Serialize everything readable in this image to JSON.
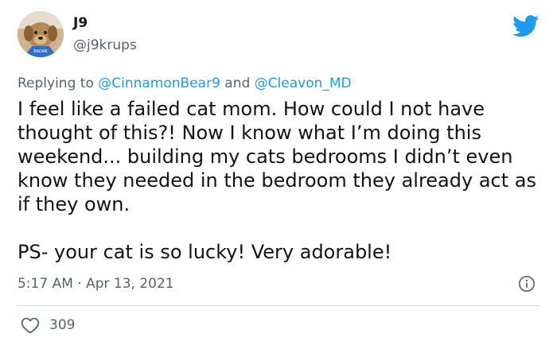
{
  "author": {
    "display_name": "J9",
    "handle": "@j9krups",
    "avatar_icon": "dog-avatar"
  },
  "reply_context": {
    "prefix": "Replying to ",
    "mention_1": "@CinnamonBear9",
    "joiner": " and ",
    "mention_2": "@Cleavon_MD"
  },
  "tweet": {
    "paragraph_1": "I feel like a failed cat mom. How could I not have thought of this?! Now I know what I’m doing this weekend... building my cats bedrooms I didn’t even know they needed in the bedroom they already act as if they own.",
    "paragraph_2": "PS- your cat is so lucky! Very adorable!"
  },
  "meta": {
    "timestamp": "5:17 AM · Apr 13, 2021"
  },
  "actions": {
    "like_count": "309",
    "like_icon": "heart-icon",
    "info_icon": "info-icon"
  },
  "brand": {
    "logo_icon": "twitter-bird-icon",
    "accent_color": "#1d9bf0",
    "secondary_text_color": "#536471"
  }
}
